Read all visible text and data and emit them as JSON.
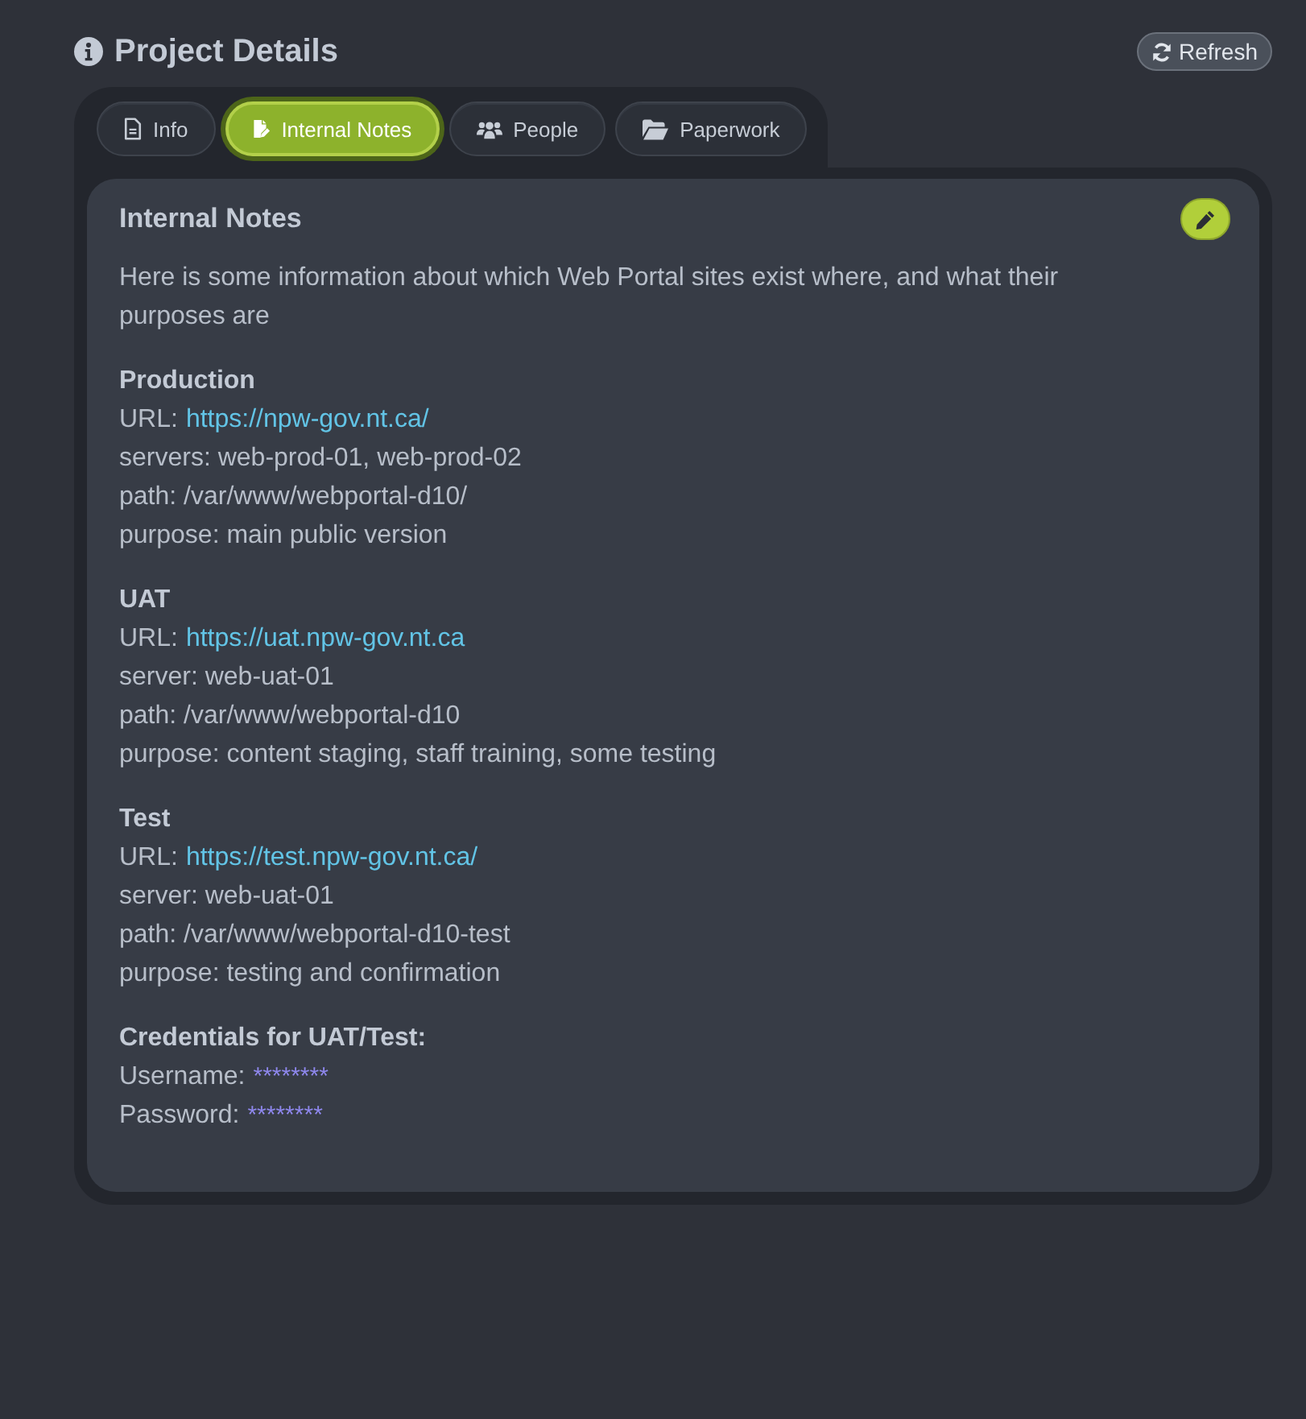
{
  "header": {
    "title": "Project Details",
    "refresh_button": "Refresh"
  },
  "tabs": [
    {
      "label": "Info",
      "selected": false
    },
    {
      "label": "Internal Notes",
      "selected": true
    },
    {
      "label": "People",
      "selected": false
    },
    {
      "label": "Paperwork",
      "selected": false
    }
  ],
  "panel": {
    "title": "Internal Notes",
    "intro": "Here is some information about which Web Portal sites exist where, and what their purposes are",
    "sections": [
      {
        "heading": "Production",
        "lines": [
          {
            "kind": "link",
            "label": "URL:",
            "value": "https://npw-gov.nt.ca/"
          },
          {
            "kind": "text",
            "text": "servers: web-prod-01, web-prod-02"
          },
          {
            "kind": "text",
            "text": "path: /var/www/webportal-d10/"
          },
          {
            "kind": "text",
            "text": "purpose: main public version"
          }
        ]
      },
      {
        "heading": "UAT",
        "lines": [
          {
            "kind": "link",
            "label": "URL:",
            "value": "https://uat.npw-gov.nt.ca"
          },
          {
            "kind": "text",
            "text": "server: web-uat-01"
          },
          {
            "kind": "text",
            "text": "path: /var/www/webportal-d10"
          },
          {
            "kind": "text",
            "text": "purpose: content staging, staff training, some testing"
          }
        ]
      },
      {
        "heading": "Test",
        "lines": [
          {
            "kind": "link",
            "label": "URL:",
            "value": "https://test.npw-gov.nt.ca/"
          },
          {
            "kind": "text",
            "text": "server: web-uat-01"
          },
          {
            "kind": "text",
            "text": "path: /var/www/webportal-d10-test"
          },
          {
            "kind": "text",
            "text": "purpose: testing and confirmation"
          }
        ]
      },
      {
        "heading": "Credentials for UAT/Test:",
        "lines": [
          {
            "kind": "secret",
            "label": "Username:",
            "value": "********"
          },
          {
            "kind": "secret",
            "label": "Password:",
            "value": "********"
          }
        ]
      }
    ]
  }
}
